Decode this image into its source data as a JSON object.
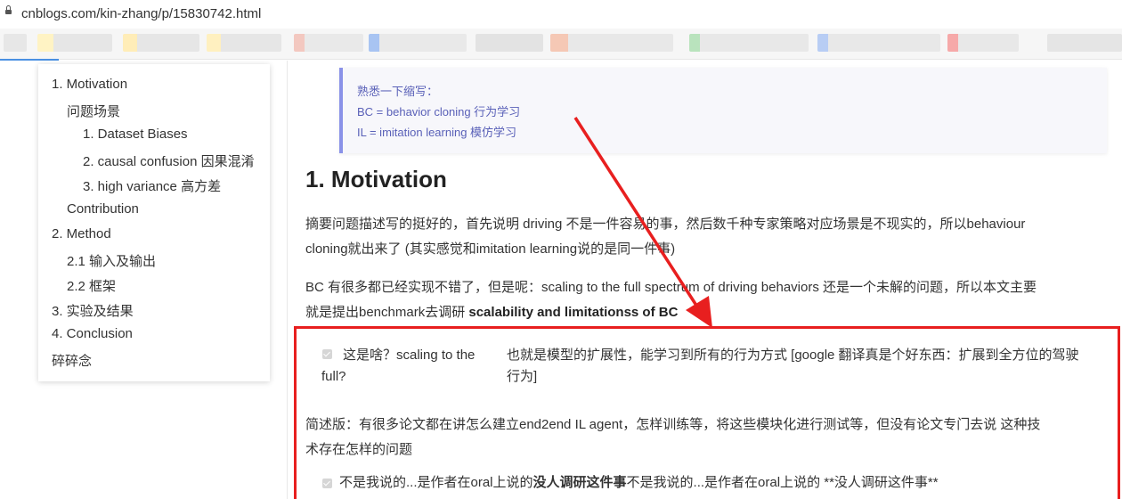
{
  "browser": {
    "url": "cnblogs.com/kin-zhang/p/15830742.html"
  },
  "toc": [
    "1. Motivation",
    "问题场景",
    "1. Dataset Biases",
    "2. causal confusion 因果混淆",
    "3. high variance 高方差",
    "Contribution",
    "2. Method",
    "2.1 输入及输出",
    "2.2 框架",
    "3. 实验及结果",
    "4. Conclusion",
    "碎碎念"
  ],
  "note": {
    "line1": "熟悉一下缩写：",
    "line2": "BC = behavior cloning 行为学习",
    "line3": "IL = imitation learning 模仿学习"
  },
  "article": {
    "heading": "1. Motivation",
    "para1_line1": "摘要问题描述写的挺好的，首先说明 driving 不是一件容易的事，然后数千种专家策略对应场景是不现实的，所以behaviour",
    "para1_line2": "cloning就出来了 (其实感觉和imitation learning说的是同一件事)",
    "para2_line1": "BC 有很多都已经实现不错了，但是呢：scaling to the full spectrum of driving behaviors 还是一个未解的问题，所以本文主要",
    "para2_line2_a": "就是提出benchmark去调研 ",
    "para2_line2_b": "scalability and limitationss of BC",
    "q1_left_a": "这是啥？scaling to the",
    "q1_left_b": "full?",
    "q1_right_a": "也就是模型的扩展性，能学习到所有的行为方式 [google 翻译真是个好东西：扩展到全方位的驾驶",
    "q1_right_b": "行为]",
    "summary_line1": "简述版：有很多论文都在讲怎么建立end2end IL agent，怎样训练等，将这些模块化进行测试等，但没有论文专门去说 这种技",
    "summary_line2": "术存在怎样的问题",
    "q2_a": "不是我说的...是作者在oral上说的",
    "q2_b": "没人调研这件事",
    "q2_c": "不是我说的...是作者在oral上说的 **没人调研这件事**"
  },
  "colors": {
    "annotation": "#e81f1f",
    "note_text": "#5a61b8",
    "note_border": "#8a92e8"
  }
}
